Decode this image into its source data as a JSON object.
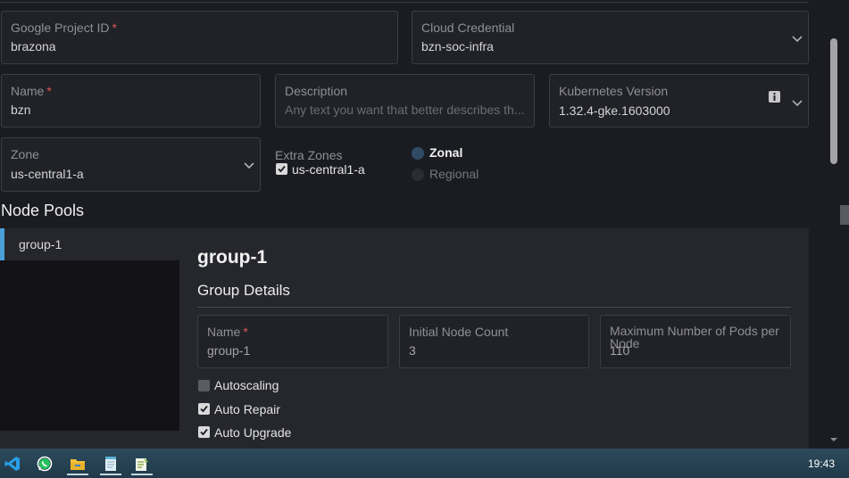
{
  "form": {
    "project_id": {
      "label": "Google Project ID",
      "required": "*",
      "value": "brazona"
    },
    "credential": {
      "label": "Cloud Credential",
      "value": "bzn-soc-infra"
    },
    "name": {
      "label": "Name",
      "required": "*",
      "value": "bzn"
    },
    "description": {
      "label": "Description",
      "placeholder": "Any text you want that better describes th..."
    },
    "k8s_version": {
      "label": "Kubernetes Version",
      "value": "1.32.4-gke.1603000"
    },
    "zone": {
      "label": "Zone",
      "value": "us-central1-a"
    },
    "extra_zones": {
      "label": "Extra Zones",
      "option": "us-central1-a",
      "checked": true
    },
    "location_type": {
      "zonal": "Zonal",
      "regional": "Regional",
      "selected": "Zonal"
    }
  },
  "node_pools": {
    "title": "Node Pools",
    "items": [
      "group-1"
    ],
    "selected": {
      "title": "group-1",
      "section": "Group Details",
      "name": {
        "label": "Name",
        "required": "*",
        "value": "group-1"
      },
      "initial_node_count": {
        "label": "Initial Node Count",
        "value": "3"
      },
      "max_pods": {
        "label": "Maximum Number of Pods per Node",
        "value": "110"
      },
      "autoscaling": {
        "label": "Autoscaling",
        "checked": false
      },
      "auto_repair": {
        "label": "Auto Repair",
        "checked": true
      },
      "auto_upgrade": {
        "label": "Auto Upgrade",
        "checked": true
      }
    }
  },
  "taskbar": {
    "icons": [
      "vscode-icon",
      "whatsapp-icon",
      "file-explorer-icon",
      "notepad-icon",
      "notepad-plus-icon"
    ],
    "clock": "19:43"
  },
  "colors": {
    "accent": "#4a9fd8",
    "required": "#e05555",
    "background": "#1b1c21"
  }
}
